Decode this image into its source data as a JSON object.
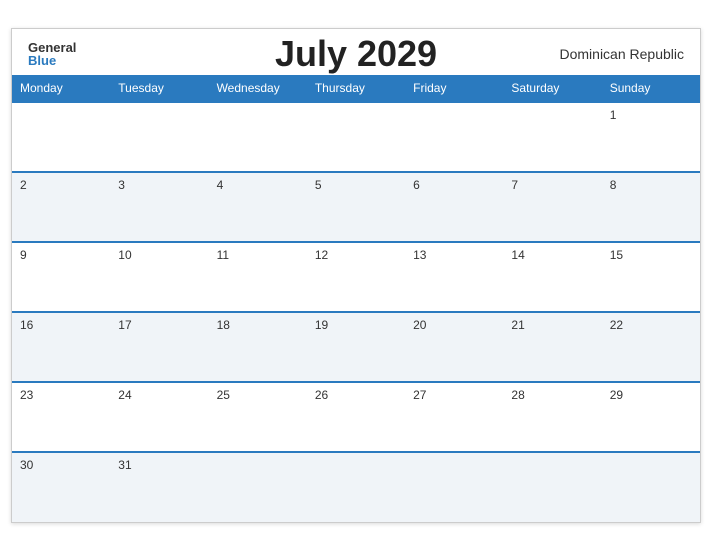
{
  "header": {
    "title": "July 2029",
    "country": "Dominican Republic",
    "logo_general": "General",
    "logo_blue": "Blue"
  },
  "weekdays": [
    "Monday",
    "Tuesday",
    "Wednesday",
    "Thursday",
    "Friday",
    "Saturday",
    "Sunday"
  ],
  "weeks": [
    [
      "",
      "",
      "",
      "",
      "",
      "",
      "1"
    ],
    [
      "2",
      "3",
      "4",
      "5",
      "6",
      "7",
      "8"
    ],
    [
      "9",
      "10",
      "11",
      "12",
      "13",
      "14",
      "15"
    ],
    [
      "16",
      "17",
      "18",
      "19",
      "20",
      "21",
      "22"
    ],
    [
      "23",
      "24",
      "25",
      "26",
      "27",
      "28",
      "29"
    ],
    [
      "30",
      "31",
      "",
      "",
      "",
      "",
      ""
    ]
  ]
}
